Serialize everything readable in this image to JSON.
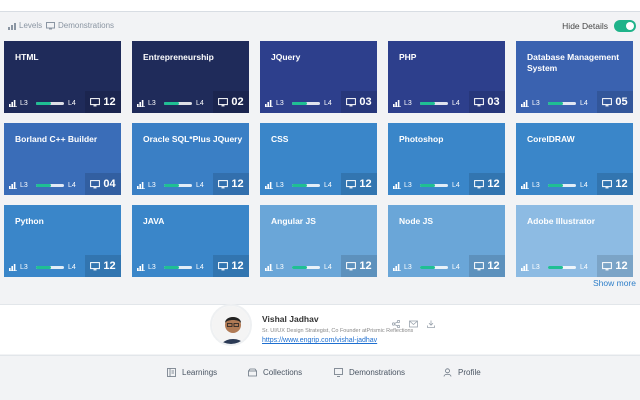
{
  "view_tabs": {
    "levels_label": "Levels",
    "demonstrations_label": "Demonstrations"
  },
  "hide_details": {
    "label": "Hide Details",
    "on": true
  },
  "tiles": [
    {
      "title": "HTML",
      "from": "L3",
      "to": "L4",
      "count": "12",
      "color": "#1f2b5a"
    },
    {
      "title": "Entrepreneurship",
      "from": "L3",
      "to": "L4",
      "count": "02",
      "color": "#1f2b5a"
    },
    {
      "title": "JQuery",
      "from": "L3",
      "to": "L4",
      "count": "03",
      "color": "#2d3f8c"
    },
    {
      "title": "PHP",
      "from": "L3",
      "to": "L4",
      "count": "03",
      "color": "#2d3f8c"
    },
    {
      "title": "Database Management System",
      "from": "L3",
      "to": "L4",
      "count": "05",
      "color": "#3a62b0"
    },
    {
      "title": "Borland C++ Builder",
      "from": "L3",
      "to": "L4",
      "count": "04",
      "color": "#3a6db8"
    },
    {
      "title": "Oracle SQL*Plus JQuery",
      "from": "L3",
      "to": "L4",
      "count": "12",
      "color": "#3a7fc5"
    },
    {
      "title": "CSS",
      "from": "L3",
      "to": "L4",
      "count": "12",
      "color": "#3a86c9"
    },
    {
      "title": "Photoshop",
      "from": "L3",
      "to": "L4",
      "count": "12",
      "color": "#3a86c9"
    },
    {
      "title": "CorelDRAW",
      "from": "L3",
      "to": "L4",
      "count": "12",
      "color": "#3a86c9"
    },
    {
      "title": "Python",
      "from": "L3",
      "to": "L4",
      "count": "12",
      "color": "#3a86c9"
    },
    {
      "title": "JAVA",
      "from": "L3",
      "to": "L4",
      "count": "12",
      "color": "#3a86c9"
    },
    {
      "title": "Angular JS",
      "from": "L3",
      "to": "L4",
      "count": "12",
      "color": "#6aa6d8"
    },
    {
      "title": "Node JS",
      "from": "L3",
      "to": "L4",
      "count": "12",
      "color": "#6aa6d8"
    },
    {
      "title": "Adobe Illustrator",
      "from": "L3",
      "to": "L4",
      "count": "12",
      "color": "#8dbbe3"
    }
  ],
  "show_more": "Show more",
  "profile": {
    "name": "Vishal Jadhav",
    "role": "Sr. UI/UX Design Strategist, Co Founder atPrismic Reflections",
    "link": "https://www.engrip.com/vishal-jadhav",
    "actions": [
      "share-icon",
      "mail-icon",
      "download-icon"
    ]
  },
  "bottom_nav": [
    {
      "label": "Learnings",
      "icon": "learnings-icon"
    },
    {
      "label": "Collections",
      "icon": "collections-icon"
    },
    {
      "label": "Demonstrations",
      "icon": "demonstrations-icon"
    },
    {
      "label": "Profile",
      "icon": "profile-icon"
    }
  ],
  "colors": {
    "accent_green": "#1fb38a",
    "link_blue": "#1e6fd0"
  }
}
